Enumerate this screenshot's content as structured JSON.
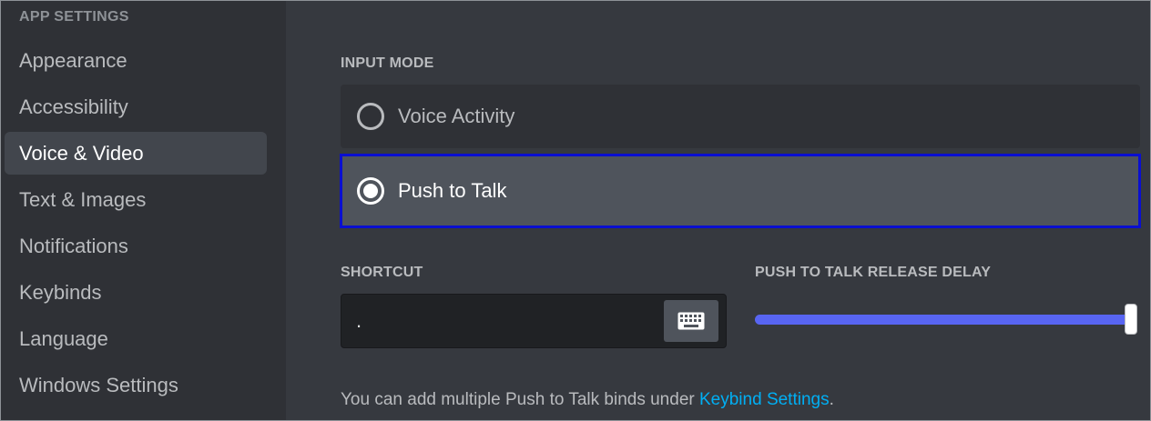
{
  "sidebar": {
    "header": "APP SETTINGS",
    "items": [
      {
        "label": "Appearance"
      },
      {
        "label": "Accessibility"
      },
      {
        "label": "Voice & Video"
      },
      {
        "label": "Text & Images"
      },
      {
        "label": "Notifications"
      },
      {
        "label": "Keybinds"
      },
      {
        "label": "Language"
      },
      {
        "label": "Windows Settings"
      }
    ],
    "active_index": 2
  },
  "input_mode": {
    "label": "INPUT MODE",
    "options": [
      {
        "label": "Voice Activity",
        "selected": false
      },
      {
        "label": "Push to Talk",
        "selected": true
      }
    ]
  },
  "shortcut": {
    "label": "SHORTCUT",
    "value": ".",
    "record_icon": "keyboard-icon"
  },
  "release_delay": {
    "label": "PUSH TO TALK RELEASE DELAY",
    "fraction": 1.0
  },
  "help": {
    "text": "You can add multiple Push to Talk binds under ",
    "link": "Keybind Settings",
    "suffix": "."
  },
  "colors": {
    "accent": "#5865f2",
    "link": "#00aff4",
    "highlight_outline": "#0a0fd0",
    "sidebar_bg": "#2f3136",
    "main_bg": "#36393f"
  }
}
